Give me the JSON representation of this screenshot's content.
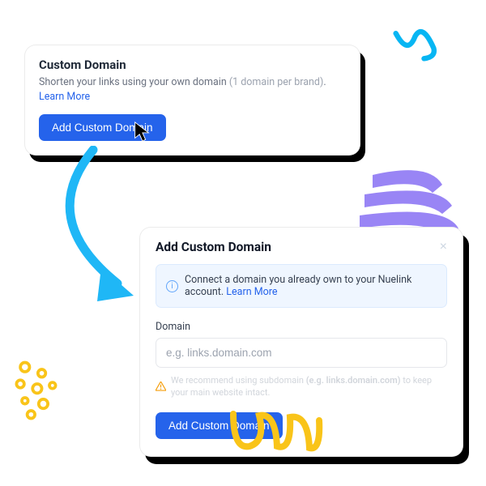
{
  "card1": {
    "title": "Custom Domain",
    "subtitle_pre": "Shorten your links using your own domain ",
    "subtitle_note": "(1 domain per brand)",
    "subtitle_post": ". ",
    "learn_more": "Learn More",
    "button": "Add Custom Domain"
  },
  "card2": {
    "title": "Add Custom Domain",
    "banner_text": "Connect a domain you already own to your Nuelink account. ",
    "banner_link": "Learn More",
    "field_label": "Domain",
    "placeholder": "e.g. links.domain.com",
    "hint_pre": "We recommend using subdomain ",
    "hint_example": "(e.g. links.domain.com)",
    "hint_post": " to keep your main website intact.",
    "button": "Add Custom Domain"
  }
}
